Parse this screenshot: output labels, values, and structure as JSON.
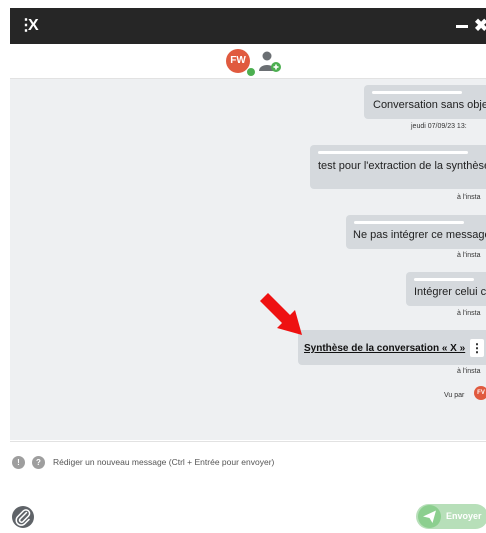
{
  "window": {
    "menu_glyph": "⋮",
    "title": "X",
    "close_glyph": "✖"
  },
  "participants": {
    "avatar_initials": "FW"
  },
  "messages": [
    {
      "text": "Conversation sans objet",
      "time": "jeudi 07/09/23 13:"
    },
    {
      "text": "test pour l'extraction de la synthèse",
      "time": "à l'insta"
    },
    {
      "text": "Ne pas intégrer ce message",
      "time": "à l'insta"
    },
    {
      "text": "Intégrer celui ci",
      "time": "à l'insta"
    }
  ],
  "synthesis": {
    "link_text": "Synthèse de la conversation « X »",
    "menu_glyph": "⋮",
    "time": "à l'insta"
  },
  "seen": {
    "label": "Vu par",
    "initials": "FV"
  },
  "composer": {
    "info_glyph_1": "!",
    "info_glyph_2": "?",
    "placeholder": "Rédiger un nouveau message (Ctrl + Entrée pour envoyer)",
    "send_label": "Envoyer"
  },
  "colors": {
    "titlebar": "#262626",
    "accent_avatar": "#e05a3f",
    "online": "#4caf50",
    "chat_bg": "#eef0f2",
    "bubble": "#d5d9dd",
    "send": "#b7dfb9",
    "arrow": "#ee1111"
  },
  "icons": {
    "attach": "paperclip-icon",
    "send": "paper-plane-icon",
    "add_user": "add-user-icon",
    "pointer": "red-arrow-annotation"
  }
}
